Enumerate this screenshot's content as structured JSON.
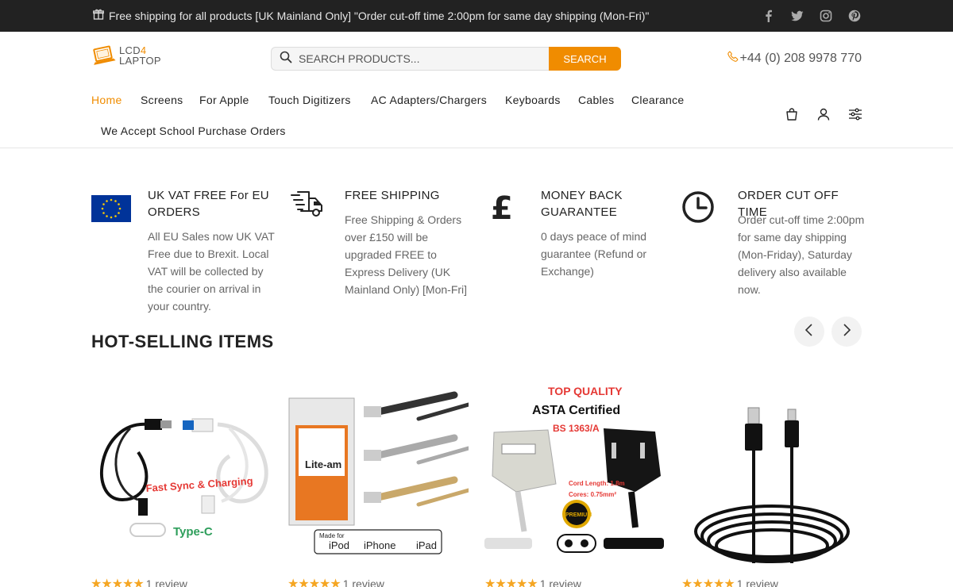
{
  "topbar": {
    "promo": "Free shipping for all products [UK Mainland Only] \"Order cut-off time 2:00pm for same day shipping (Mon-Fri)\"",
    "social": [
      "facebook-icon",
      "twitter-icon",
      "instagram-icon",
      "pinterest-icon"
    ]
  },
  "header": {
    "logo_line1_a": "LCD",
    "logo_line1_b": "4",
    "logo_line2": "LAPTOP",
    "search_placeholder": "SEARCH PRODUCTS...",
    "search_button": "SEARCH",
    "phone": "+44 (0) 208 9978 770"
  },
  "nav": {
    "items": [
      "Home",
      "Screens",
      "For Apple",
      "Touch Digitizers",
      "AC Adapters/Chargers",
      "Keyboards",
      "Cables",
      "Clearance",
      "We Accept School Purchase Orders"
    ]
  },
  "features": [
    {
      "title": "UK VAT FREE For EU ORDERS",
      "text": "All EU Sales now UK VAT Free due to Brexit. Local VAT will be collected by the courier on arrival in your country.",
      "icon": "eu-flag-icon"
    },
    {
      "title": "FREE SHIPPING",
      "text": "Free Shipping & Orders over £150 will be upgraded FREE to Express Delivery (UK Mainland Only) [Mon-Fri]",
      "icon": "delivery-truck-icon"
    },
    {
      "title": "MONEY BACK GUARANTEE",
      "text": "0 days peace of mind guarantee (Refund or Exchange)",
      "icon": "pound-icon"
    },
    {
      "title": "ORDER CUT OFF TIME",
      "text": "Order cut-off time 2:00pm for same day shipping (Mon-Friday), Saturday delivery also available now.",
      "icon": "clock-icon"
    }
  ],
  "hot_selling": {
    "title": "HOT-SELLING ITEMS",
    "products": [
      {
        "review": "1 review",
        "img_text_1": "Fast Sync & Charging",
        "img_text_2": "Type-C"
      },
      {
        "review": "1 review",
        "img_text_1": "Lite-am",
        "img_text_2": "Made for",
        "img_text_3": "iPod",
        "img_text_4": "iPhone",
        "img_text_5": "iPad"
      },
      {
        "review": "1 review",
        "img_text_1": "TOP QUALITY",
        "img_text_2": "ASTA Certified",
        "img_text_3": "BS 1363/A",
        "img_text_4": "Cord Length: 1.8m",
        "img_text_5": "Cores: 0.75mm²",
        "img_text_6": "PREMIUM"
      },
      {
        "review": "1 review"
      }
    ],
    "rating": 5
  },
  "colors": {
    "accent": "#f08c00",
    "topbar": "#222222",
    "star": "#f5a623"
  }
}
